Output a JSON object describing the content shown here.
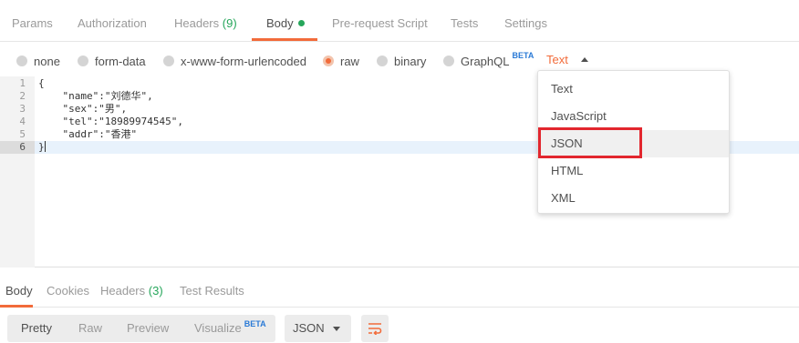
{
  "request_tabs": {
    "params": "Params",
    "authorization": "Authorization",
    "headers_label": "Headers",
    "headers_count": "(9)",
    "body": "Body",
    "pre_request": "Pre-request Script",
    "tests": "Tests",
    "settings": "Settings"
  },
  "body_modes": {
    "none": "none",
    "form_data": "form-data",
    "urlencoded": "x-www-form-urlencoded",
    "raw": "raw",
    "binary": "binary",
    "graphql": "GraphQL",
    "graphql_badge": "BETA",
    "selected": "raw",
    "type_value": "Text"
  },
  "editor": {
    "line_numbers": [
      "1",
      "2",
      "3",
      "4",
      "5",
      "6"
    ],
    "lines": [
      "{",
      "    \"name\":\"刘德华\",",
      "    \"sex\":\"男\",",
      "    \"tel\":\"18989974545\",",
      "    \"addr\":\"香港\"",
      "}"
    ]
  },
  "type_dropdown": {
    "items": [
      "Text",
      "JavaScript",
      "JSON",
      "HTML",
      "XML"
    ],
    "highlighted": "JSON"
  },
  "response_tabs": {
    "body": "Body",
    "cookies": "Cookies",
    "headers_label": "Headers",
    "headers_count": "(3)",
    "test_results": "Test Results"
  },
  "response_toolbar": {
    "pretty": "Pretty",
    "raw": "Raw",
    "preview": "Preview",
    "visualize": "Visualize",
    "visualize_badge": "BETA",
    "format_value": "JSON"
  },
  "colors": {
    "accent": "#f26b3a",
    "count_green": "#26a65b",
    "beta_blue": "#2a7ad6",
    "highlight_red": "#e2262e"
  }
}
